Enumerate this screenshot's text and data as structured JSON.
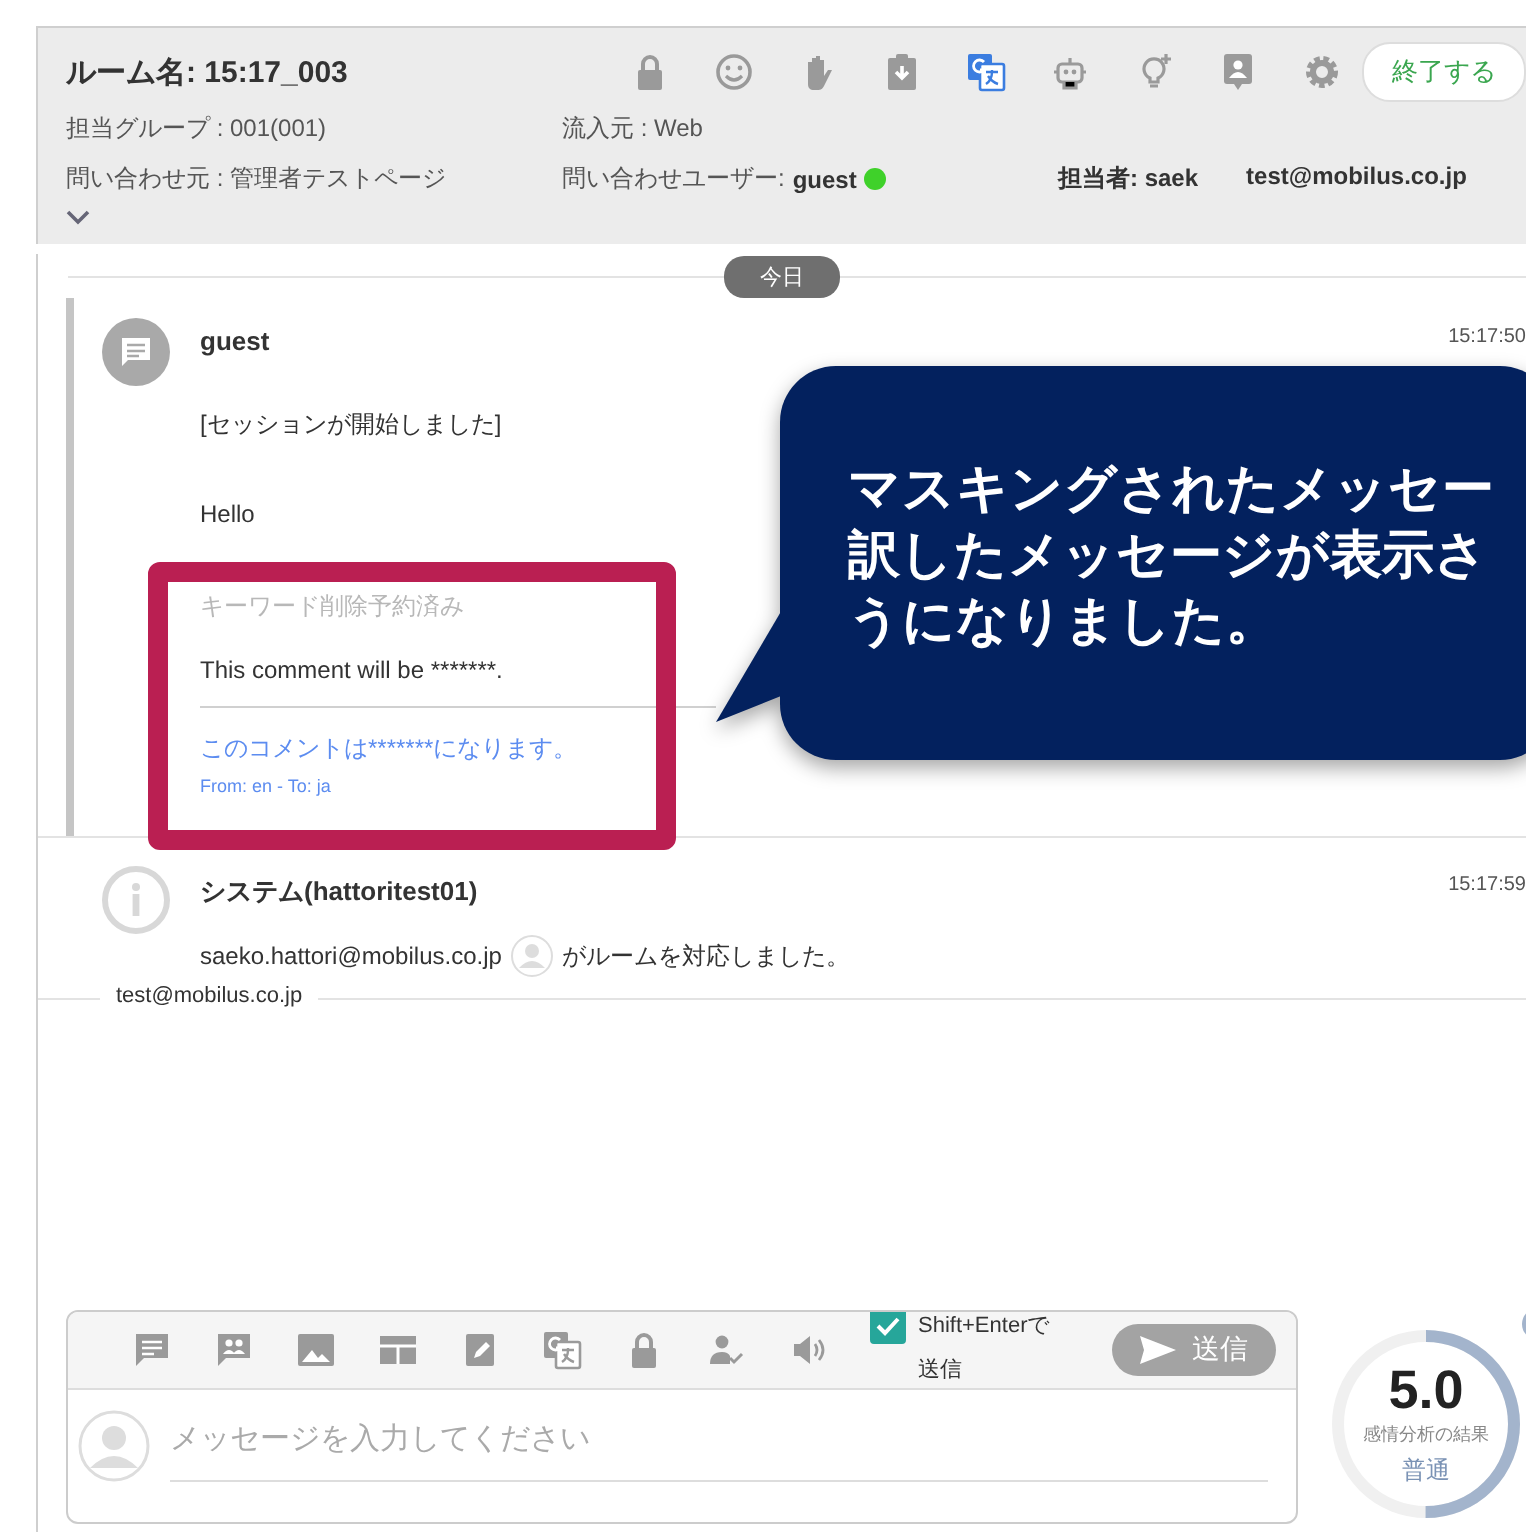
{
  "header": {
    "room_title": "ルーム名: 15:17_003",
    "end_button": "終了する",
    "toolbar": [
      {
        "kind": "lock",
        "highlighted": false
      },
      {
        "kind": "smiley",
        "highlighted": false
      },
      {
        "kind": "hand",
        "highlighted": false
      },
      {
        "kind": "clipboard",
        "highlighted": false
      },
      {
        "kind": "translate",
        "highlighted": true
      },
      {
        "kind": "robot",
        "highlighted": false
      },
      {
        "kind": "bulb",
        "highlighted": false
      },
      {
        "kind": "contact",
        "highlighted": false
      },
      {
        "kind": "gear",
        "highlighted": false
      }
    ],
    "group": "担当グループ : 001(001)",
    "source": "流入元 : Web",
    "origin": "問い合わせ元 : 管理者テストページ",
    "user_label": "問い合わせユーザー:",
    "user_name": "guest",
    "user_online": true,
    "agent": "担当者: saek",
    "agent_email": "test@mobilus.co.jp"
  },
  "date_chip": "今日",
  "messages": [
    {
      "kind": "guest",
      "sender": "guest",
      "time": "15:17:50",
      "lines": [
        "[セッションが開始しました]",
        "Hello"
      ],
      "note": {
        "status": "キーワード削除予約済み",
        "original": "This comment will be *******.",
        "translation": "このコメントは*******になります。",
        "languages": "From: en - To: ja"
      }
    },
    {
      "kind": "system",
      "sender": "システム(hattoritest01)",
      "time": "15:17:59",
      "email": "saeko.hattori@mobilus.co.jp",
      "text": "がルームを対応しました。"
    }
  ],
  "tooltip": "test@mobilus.co.jp",
  "composer": {
    "tools": [
      {
        "kind": "chat"
      },
      {
        "kind": "group"
      },
      {
        "kind": "image"
      },
      {
        "kind": "layout"
      },
      {
        "kind": "edit"
      },
      {
        "kind": "translate"
      },
      {
        "kind": "lock"
      },
      {
        "kind": "personcheck"
      },
      {
        "kind": "speaker"
      }
    ],
    "shift_enter": {
      "label": "Shift+Enterで送信",
      "checked": true
    },
    "send": "送信",
    "placeholder": "メッセージを入力してください"
  },
  "sentiment": {
    "score": "5.0",
    "caption": "感情分析の結果",
    "result": "普通",
    "level": 0.5
  },
  "callout": {
    "lines": [
      "マスキングされたメッセー",
      "訳したメッセージが表示さ",
      "うになりました。"
    ]
  }
}
